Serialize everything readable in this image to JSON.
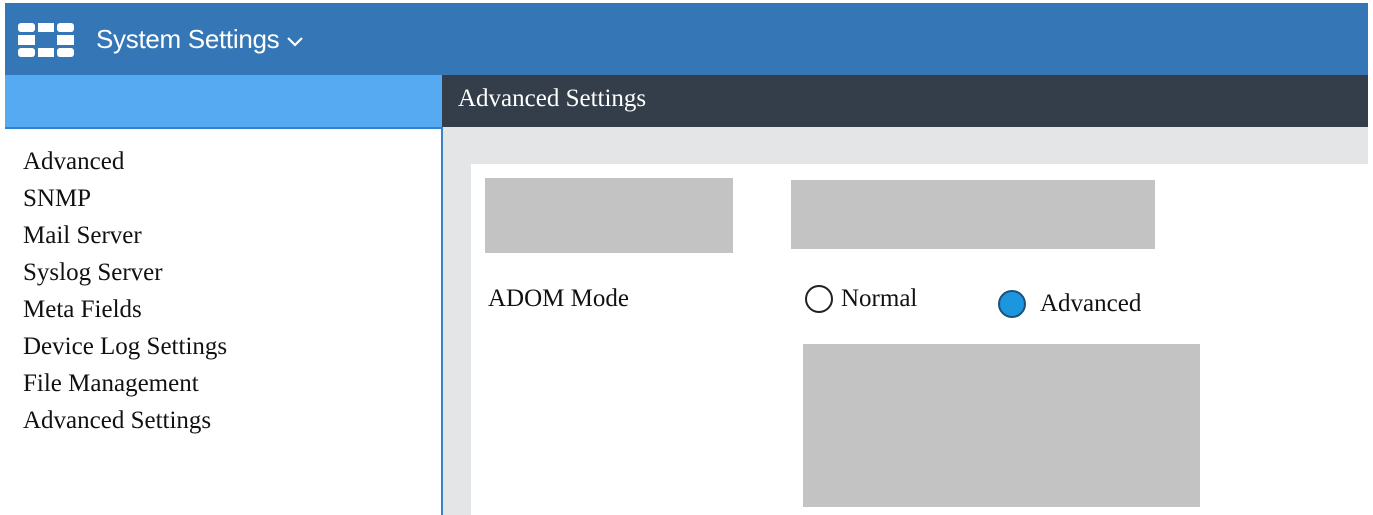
{
  "header": {
    "app_title": "System Settings",
    "logo_icon": "fortinet-logo-icon",
    "dropdown_icon": "chevron-down-icon",
    "color": "#3577b6"
  },
  "sidebar": {
    "header_color": "#55aaf2",
    "items": [
      {
        "label": "Advanced"
      },
      {
        "label": "SNMP"
      },
      {
        "label": "Mail Server"
      },
      {
        "label": "Syslog Server"
      },
      {
        "label": "Meta Fields"
      },
      {
        "label": "Device Log Settings"
      },
      {
        "label": "File Management"
      },
      {
        "label": "Advanced Settings"
      }
    ]
  },
  "content": {
    "title": "Advanced Settings",
    "header_color": "#333e4a",
    "adom_mode": {
      "label": "ADOM Mode",
      "options": [
        {
          "label": "Normal",
          "selected": false
        },
        {
          "label": "Advanced",
          "selected": true
        }
      ],
      "selected_color": "#1b96df"
    },
    "redacted_color": "#c3c3c3"
  }
}
